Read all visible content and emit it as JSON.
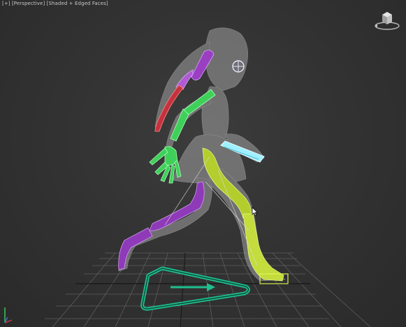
{
  "viewport": {
    "menu_label": "[+]",
    "view_label": "[Perspective]",
    "shading_label": "[Shaded + Edged Faces]"
  },
  "viewcube": {
    "icon": "viewcube-icon"
  },
  "colors": {
    "background": "#333333",
    "grid": "#6a6a6a",
    "body_ghost": "#a9a9a9",
    "spine_purple": "#9a3fc2",
    "arm_red": "#c5323e",
    "arm_green": "#3fd05a",
    "leg_yellow": "#c9e23a",
    "hand_cyan": "#7fe7ff",
    "root_teal": "#1fbf8f"
  }
}
